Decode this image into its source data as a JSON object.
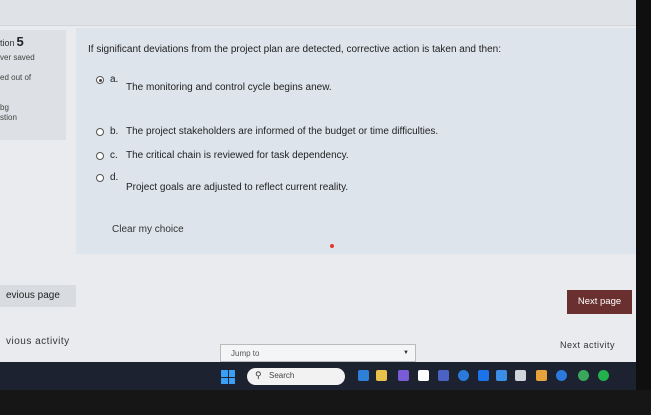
{
  "info": {
    "question_label": "tion",
    "question_number": "5",
    "line1": "ver saved",
    "line2": "ed out of",
    "line3": "bg",
    "line4": "stion"
  },
  "question": {
    "prompt": "If significant deviations from the project plan are detected, corrective action is taken and then:",
    "options": [
      {
        "letter": "a.",
        "text": "The monitoring and control cycle begins anew.",
        "checked": true
      },
      {
        "letter": "b.",
        "text": "The project stakeholders are informed of the budget or time difficulties.",
        "checked": false
      },
      {
        "letter": "c.",
        "text": "The critical chain is reviewed for task dependency.",
        "checked": false
      },
      {
        "letter": "d.",
        "text": "Project goals are adjusted to reflect current reality.",
        "checked": false
      }
    ],
    "clear_label": "Clear my choice"
  },
  "nav": {
    "prev_page": "evious page",
    "next_page": "Next page",
    "prev_activity": "vious activity",
    "next_activity": "Next activity",
    "jump_placeholder": "Jump to"
  },
  "taskbar": {
    "search_label": "Search"
  },
  "colors": {
    "next_button": "#6a2f2f",
    "accent_dot": "#e03a2e",
    "taskbar": "#1d2230"
  }
}
